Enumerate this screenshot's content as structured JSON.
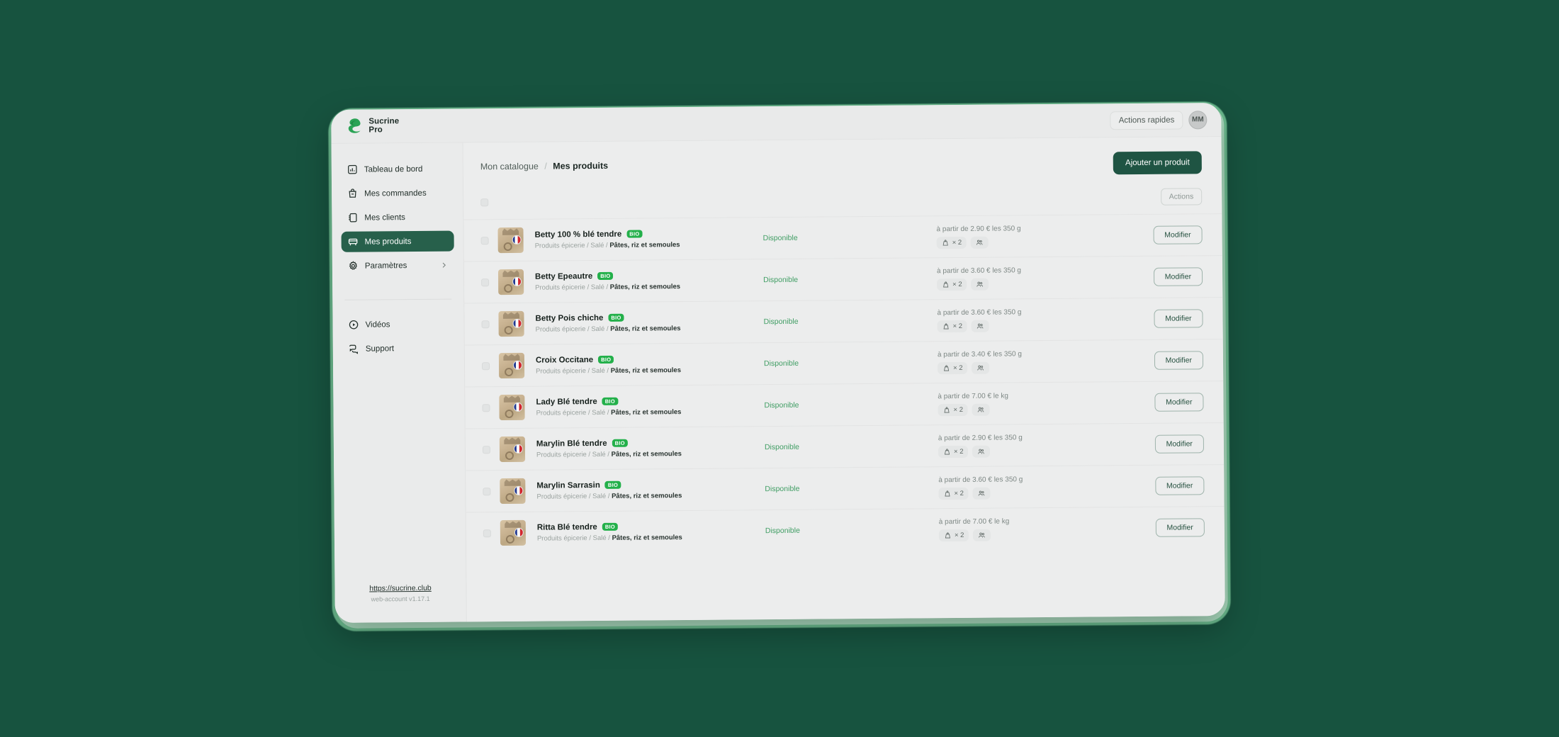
{
  "app": {
    "brand_line1": "Sucrine",
    "brand_line2": "Pro",
    "logo_icon": "sucrine-s-logo",
    "accent_green": "#1f5443",
    "bio_green": "#23b04a",
    "page_bg": "#17533f"
  },
  "topbar": {
    "quick_actions_label": "Actions rapides",
    "avatar_initials": "MM"
  },
  "sidebar": {
    "items": [
      {
        "label": "Tableau de bord",
        "icon": "chart-bar-icon",
        "active": false
      },
      {
        "label": "Mes commandes",
        "icon": "shopping-bag-icon",
        "active": false
      },
      {
        "label": "Mes clients",
        "icon": "address-book-icon",
        "active": false
      },
      {
        "label": "Mes produits",
        "icon": "storefront-icon",
        "active": true
      },
      {
        "label": "Paramètres",
        "icon": "gear-icon",
        "active": false,
        "chevron": "chevron-right-icon"
      }
    ],
    "secondary_items": [
      {
        "label": "Vidéos",
        "icon": "play-circle-icon"
      },
      {
        "label": "Support",
        "icon": "chat-bubbles-icon"
      }
    ],
    "footer": {
      "site_link": "https://sucrine.club",
      "version": "web-account v1.17.1"
    }
  },
  "main": {
    "breadcrumb": {
      "parent": "Mon catalogue",
      "separator": "/",
      "current": "Mes produits"
    },
    "add_product_label": "Ajouter un produit",
    "actions_label": "Actions",
    "status_available": "Disponible",
    "edit_label": "Modifier",
    "quantity_chip": "× 2",
    "products": [
      {
        "name": "Betty 100 % blé tendre",
        "badge": "BIO",
        "category_prefix": "Produits épicerie / Salé / ",
        "category_leaf": "Pâtes, riz et semoules",
        "status": "Disponible",
        "price": "à partir de 2.90 € les 350 g",
        "qty": "× 2"
      },
      {
        "name": "Betty Epeautre",
        "badge": "BIO",
        "category_prefix": "Produits épicerie / Salé / ",
        "category_leaf": "Pâtes, riz et semoules",
        "status": "Disponible",
        "price": "à partir de 3.60 € les 350 g",
        "qty": "× 2"
      },
      {
        "name": "Betty Pois chiche",
        "badge": "BIO",
        "category_prefix": "Produits épicerie / Salé / ",
        "category_leaf": "Pâtes, riz et semoules",
        "status": "Disponible",
        "price": "à partir de 3.60 € les 350 g",
        "qty": "× 2"
      },
      {
        "name": "Croix Occitane",
        "badge": "BIO",
        "category_prefix": "Produits épicerie / Salé / ",
        "category_leaf": "Pâtes, riz et semoules",
        "status": "Disponible",
        "price": "à partir de 3.40 € les 350 g",
        "qty": "× 2"
      },
      {
        "name": "Lady Blé tendre",
        "badge": "BIO",
        "category_prefix": "Produits épicerie / Salé / ",
        "category_leaf": "Pâtes, riz et semoules",
        "status": "Disponible",
        "price": "à partir de 7.00 € le kg",
        "qty": "× 2"
      },
      {
        "name": "Marylin Blé tendre",
        "badge": "BIO",
        "category_prefix": "Produits épicerie / Salé / ",
        "category_leaf": "Pâtes, riz et semoules",
        "status": "Disponible",
        "price": "à partir de 2.90 € les 350 g",
        "qty": "× 2"
      },
      {
        "name": "Marylin Sarrasin",
        "badge": "BIO",
        "category_prefix": "Produits épicerie / Salé / ",
        "category_leaf": "Pâtes, riz et semoules",
        "status": "Disponible",
        "price": "à partir de 3.60 € les 350 g",
        "qty": "× 2"
      },
      {
        "name": "Ritta Blé tendre",
        "badge": "BIO",
        "category_prefix": "Produits épicerie / Salé / ",
        "category_leaf": "Pâtes, riz et semoules",
        "status": "Disponible",
        "price": "à partir de 7.00 € le kg",
        "qty": "× 2"
      }
    ]
  }
}
